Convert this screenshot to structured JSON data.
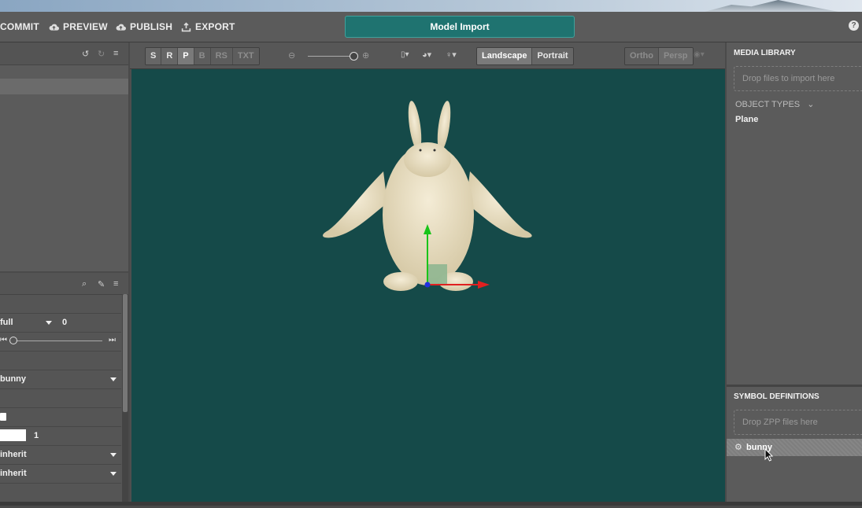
{
  "header": {
    "commit": "COMMIT",
    "preview": "PREVIEW",
    "publish": "PUBLISH",
    "export": "EXPORT",
    "title": "Model Import",
    "help": "?"
  },
  "toolbar": {
    "modes": [
      "S",
      "R",
      "P",
      "B",
      "RS",
      "TXT"
    ],
    "active_mode": "P",
    "orientation": [
      "Landscape",
      "Portrait"
    ],
    "projection": [
      "Ortho",
      "Persp"
    ]
  },
  "left_panel": {
    "dropdown_full": "full",
    "frame_value": "0",
    "symbol_select": "bunny",
    "opacity_value": "1",
    "inherit_1": "inherit",
    "inherit_2": "inherit"
  },
  "right_panel": {
    "media_library": "MEDIA LIBRARY",
    "drop_files": "Drop files to import here",
    "object_types": "OBJECT TYPES",
    "plane": "Plane",
    "symbol_definitions": "SYMBOL DEFINITIONS",
    "drop_zpp": "Drop ZPP files here",
    "bunny": "bunny"
  },
  "colors": {
    "viewport": "#154a49",
    "accent": "#1f7370"
  }
}
